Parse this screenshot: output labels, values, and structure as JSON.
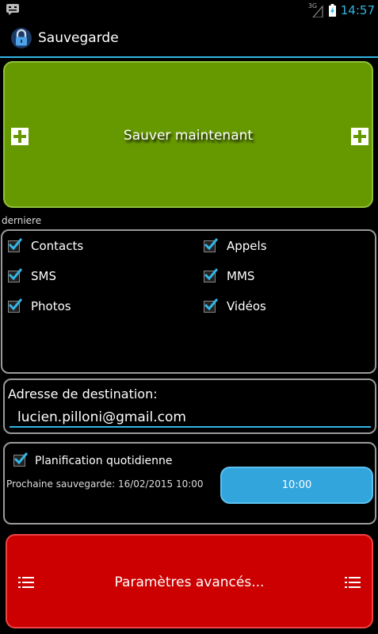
{
  "status_bar": {
    "network": "3G",
    "time": "14:57",
    "icons": [
      "notification-icon",
      "signal-icon",
      "battery-icon"
    ]
  },
  "action_bar": {
    "title": "Sauvegarde",
    "app_icon": "lock-icon"
  },
  "main": {
    "save_button": {
      "label": "Sauver maintenant",
      "icon": "plus-icon"
    },
    "section_label": "derniere",
    "data_types": [
      {
        "label": "Contacts",
        "checked": true
      },
      {
        "label": "Appels",
        "checked": true
      },
      {
        "label": "SMS",
        "checked": true
      },
      {
        "label": "MMS",
        "checked": true
      },
      {
        "label": "Photos",
        "checked": true
      },
      {
        "label": "Vidéos",
        "checked": true
      }
    ],
    "destination": {
      "title": "Adresse de destination:",
      "value": "lucien.pilloni@gmail.com"
    },
    "schedule": {
      "label": "Planification quotidienne",
      "checked": true,
      "next_backup": "Prochaine sauvegarde: 16/02/2015 10:00",
      "time_button": "10:00"
    },
    "advanced_button": {
      "label": "Paramètres avancés...",
      "icon": "list-icon"
    }
  },
  "colors": {
    "accent": "#33b5e5",
    "save_green": "#669900",
    "advanced_red": "#cc0000",
    "time_button_blue": "#33a5dd"
  }
}
